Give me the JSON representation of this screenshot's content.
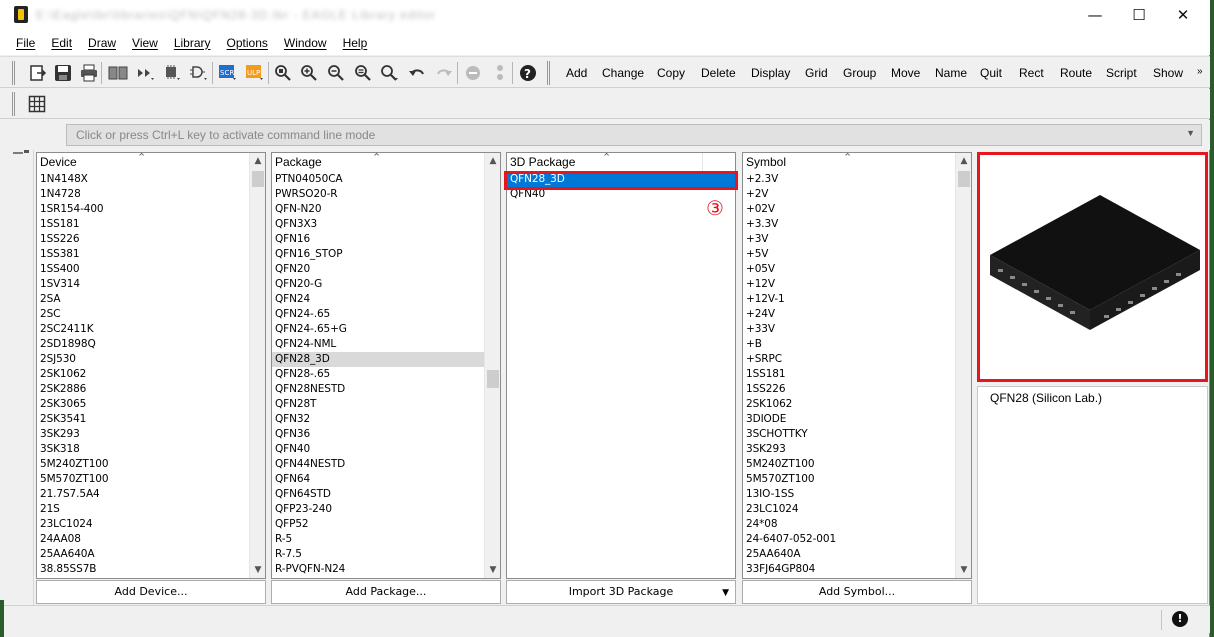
{
  "titlebar": {
    "title": "E:\\Eagle\\lbr\\libraries\\QFN\\QFN28-3D.lbr - EAGLE Library editor",
    "minimize": "—",
    "maximize": "☐",
    "close": "✕"
  },
  "menu": [
    "File",
    "Edit",
    "Draw",
    "View",
    "Library",
    "Options",
    "Window",
    "Help"
  ],
  "toolbar": {
    "commands": [
      "Add",
      "Change",
      "Copy",
      "Delete",
      "Display",
      "Grid",
      "Group",
      "Move",
      "Name",
      "Quit",
      "Rect",
      "Route",
      "Script",
      "Show"
    ],
    "overflow": "»"
  },
  "command_line": {
    "placeholder": "Click or press Ctrl+L key to activate command line mode"
  },
  "device_panel": {
    "header": "Device",
    "items": [
      "1N4148X",
      "1N4728",
      "1SR154-400",
      "1SS181",
      "1SS226",
      "1SS381",
      "1SS400",
      "1SV314",
      "2SA",
      "2SC",
      "2SC2411K",
      "2SD1898Q",
      "2SJ530",
      "2SK1062",
      "2SK2886",
      "2SK3065",
      "2SK3541",
      "3SK293",
      "3SK318",
      "5M240ZT100",
      "5M570ZT100",
      "21.7S7.5A4",
      "21S",
      "23LC1024",
      "24AA08",
      "25AA640A",
      "38.85SS7B"
    ],
    "button": "Add Device..."
  },
  "package_panel": {
    "header": "Package",
    "items": [
      "PTN04050CA",
      "PWRSO20-R",
      "QFN-N20",
      "QFN3X3",
      "QFN16",
      "QFN16_STOP",
      "QFN20",
      "QFN20-G",
      "QFN24",
      "QFN24-.65",
      "QFN24-.65+G",
      "QFN24-NML",
      "QFN28_3D",
      "QFN28-.65",
      "QFN28NESTD",
      "QFN28T",
      "QFN32",
      "QFN36",
      "QFN40",
      "QFN44NESTD",
      "QFN64",
      "QFN64STD",
      "QFP23-240",
      "QFP52",
      "R-5",
      "R-7.5",
      "R-PVQFN-N24"
    ],
    "selected_index": 12,
    "button": "Add Package..."
  },
  "package3d_panel": {
    "header": "3D Package",
    "items": [
      "QFN28_3D",
      "QFN40"
    ],
    "selected_index": 0,
    "button": "Import 3D Package"
  },
  "symbol_panel": {
    "header": "Symbol",
    "items": [
      "+2.3V",
      "+2V",
      "+02V",
      "+3.3V",
      "+3V",
      "+5V",
      "+05V",
      "+12V",
      "+12V-1",
      "+24V",
      "+33V",
      "+B",
      "+SRPC",
      "1SS181",
      "1SS226",
      "2SK1062",
      "3DIODE",
      "3SCHOTTKY",
      "3SK293",
      "5M240ZT100",
      "5M570ZT100",
      "13IO-1SS",
      "23LC1024",
      "24*08",
      "24-6407-052-001",
      "25AA640A",
      "33FJ64GP804"
    ],
    "button": "Add Symbol..."
  },
  "preview": {
    "description": "QFN28 (Silicon Lab.)"
  },
  "annotation": {
    "step": "③"
  },
  "colors": {
    "accent_red": "#e5161d",
    "selection_blue": "#0078d7"
  }
}
